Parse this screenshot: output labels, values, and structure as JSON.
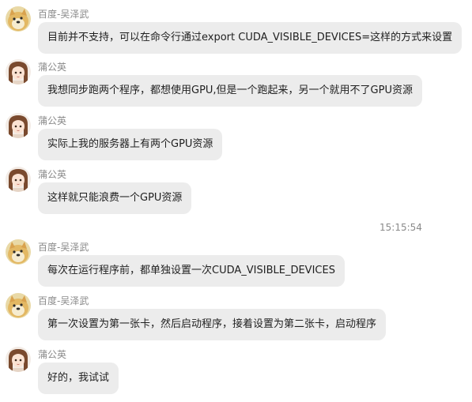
{
  "messages": [
    {
      "sender": "百度-吴泽武",
      "avatar": "doge-avatar",
      "text": "目前并不支持，可以在命令行通过export CUDA_VISIBLE_DEVICES=这样的方式来设置"
    },
    {
      "sender": "蒲公英",
      "avatar": "anime-girl-avatar",
      "text": "我想同步跑两个程序，都想使用GPU,但是一个跑起来，另一个就用不了GPU资源"
    },
    {
      "sender": "蒲公英",
      "avatar": "anime-girl-avatar",
      "text": "实际上我的服务器上有两个GPU资源"
    },
    {
      "sender": "蒲公英",
      "avatar": "anime-girl-avatar",
      "text": "这样就只能浪费一个GPU资源"
    },
    {
      "sender": "百度-吴泽武",
      "avatar": "doge-avatar",
      "text": "每次在运行程序前，都单独设置一次CUDA_VISIBLE_DEVICES"
    },
    {
      "sender": "百度-吴泽武",
      "avatar": "doge-avatar",
      "text": "第一次设置为第一张卡，然后启动程序，接着设置为第二张卡，启动程序"
    },
    {
      "sender": "蒲公英",
      "avatar": "anime-girl-avatar",
      "text": "好的，我试试"
    }
  ],
  "timestamp": "15:15:54",
  "colors": {
    "bubble": "#ececec",
    "meta_text": "#8a8a8a",
    "background": "#ffffff"
  }
}
